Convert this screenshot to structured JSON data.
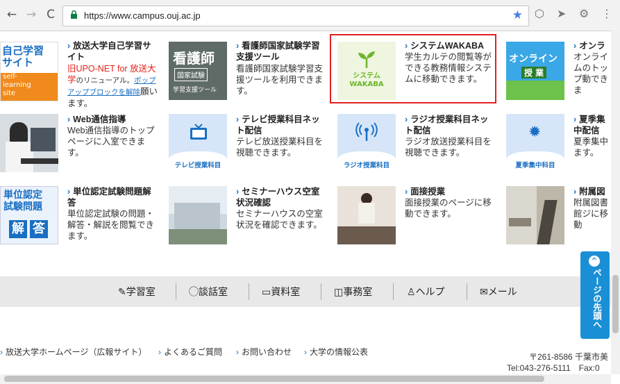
{
  "browser": {
    "url": "https://www.campus.ouj.ac.jp",
    "back": "←",
    "forward": "→",
    "reload": "C",
    "star": "★",
    "menu": "⋮"
  },
  "tiles": [
    {
      "title": "放送大学自己学習サイト",
      "desc_red": "旧UPO-NET for 放送大学",
      "desc_mid": "のリニューアル。",
      "desc_link": "ポップアップブロックを解除",
      "desc_end": "願います。",
      "thumb_text": [
        "自己学習",
        "サイト",
        "self-",
        "learning",
        "site"
      ]
    },
    {
      "title": "看護師国家試験学習支援ツール",
      "desc": "看護師国家試験学習支援ツールを利用できます。",
      "thumb_text": [
        "看護師",
        "国家試験",
        "学習支援ツール"
      ]
    },
    {
      "title": "システムWAKABA",
      "desc": "学生カルテの閲覧等ができる教務情報システムに移動できます。",
      "thumb_text": [
        "システム",
        "WAKABA"
      ]
    },
    {
      "title": "オンラ",
      "desc": "オンライムのトップ動できま",
      "thumb_text": [
        "オンライン",
        "授 業"
      ]
    },
    {
      "title": "Web通信指導",
      "desc": "Web通信指導のトップページに入室できます。"
    },
    {
      "title": "テレビ授業科目ネット配信",
      "desc": "テレビ放送授業科目を視聴できます。",
      "thumb_text": [
        "テレビ授業科目"
      ]
    },
    {
      "title": "ラジオ授業科目ネット配信",
      "desc": "ラジオ放送授業科目を視聴できます。",
      "thumb_text": [
        "ラジオ授業科目"
      ]
    },
    {
      "title": "夏季集中配信",
      "desc": "夏季集中ます。",
      "thumb_text": [
        "夏季集中科目"
      ]
    },
    {
      "title": "単位認定試験問題解答",
      "desc": "単位認定試験の問題・解答・解説を閲覧できます。",
      "thumb_text": [
        "単位認定",
        "試験問題",
        "解",
        "答"
      ]
    },
    {
      "title": "セミナーハウス空室状況確認",
      "desc": "セミナーハウスの空室状況を確認できます。"
    },
    {
      "title": "面接授業",
      "desc": "面接授業のページに移動できます。"
    },
    {
      "title": "附属図",
      "desc": "附属図書館ジに移動"
    }
  ],
  "navbar": [
    "学習室",
    "談話室",
    "資料室",
    "事務室",
    "ヘルプ",
    "メール"
  ],
  "footer_links": [
    "放送大学ホームページ（広報サイト）",
    "よくあるご質問",
    "お問い合わせ",
    "大学の情報公表"
  ],
  "address": {
    "postal": "〒261-8586 千葉市美",
    "tel": "Tel:043-276-5111　Fax:0"
  },
  "totop": "ページの先頭へ",
  "colors": {
    "accent": "#1a6fc2",
    "highlight": "#e02020",
    "totop": "#1a8fd6"
  }
}
